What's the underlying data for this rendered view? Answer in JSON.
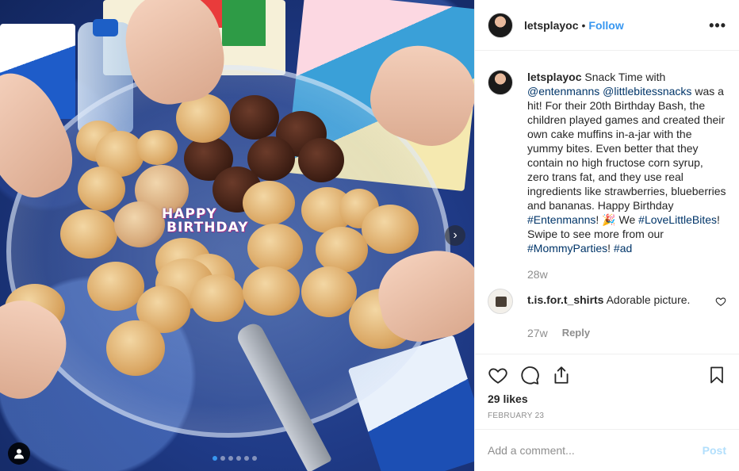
{
  "post": {
    "username": "letsplayoc",
    "follow_label": "Follow",
    "separator": "•",
    "more_label": "•••",
    "photo_text": {
      "happy": "HAPPY",
      "birthday": "BIRTHDAY"
    },
    "carousel": {
      "count": 6,
      "active_index": 0
    },
    "caption": {
      "username": "letsplayoc",
      "segments": [
        {
          "text": " Snack Time with ",
          "tag": false
        },
        {
          "text": "@entenmanns",
          "tag": true
        },
        {
          "text": " ",
          "tag": false
        },
        {
          "text": "@littlebitessnacks",
          "tag": true
        },
        {
          "text": " was a hit! For their 20th Birthday Bash, the children played games and created their own cake muffins in-a-jar with the yummy bites. Even better that they contain no high fructose corn syrup, zero trans fat, and they use real ingredients like strawberries, blueberries and bananas. Happy Birthday ",
          "tag": false
        },
        {
          "text": "#Entenmanns",
          "tag": true
        },
        {
          "text": "! 🎉 We ",
          "tag": false
        },
        {
          "text": "#LoveLittleBites",
          "tag": true
        },
        {
          "text": "! Swipe to see more from our ",
          "tag": false
        },
        {
          "text": "#MommyParties",
          "tag": true
        },
        {
          "text": "! ",
          "tag": false
        },
        {
          "text": "#ad",
          "tag": true
        }
      ],
      "time_ago": "28w"
    },
    "comments": [
      {
        "username": "t.is.for.t_shirts",
        "text": " Adorable picture.",
        "time_ago": "27w",
        "reply_label": "Reply"
      }
    ],
    "likes_label": "29 likes",
    "date_label": "FEBRUARY 23",
    "add_comment": {
      "placeholder": "Add a comment...",
      "post_label": "Post"
    }
  },
  "colors": {
    "accent": "#3897f0",
    "tag": "#003569",
    "muted": "#8e8e8e",
    "post_disabled": "#b2dffc"
  }
}
